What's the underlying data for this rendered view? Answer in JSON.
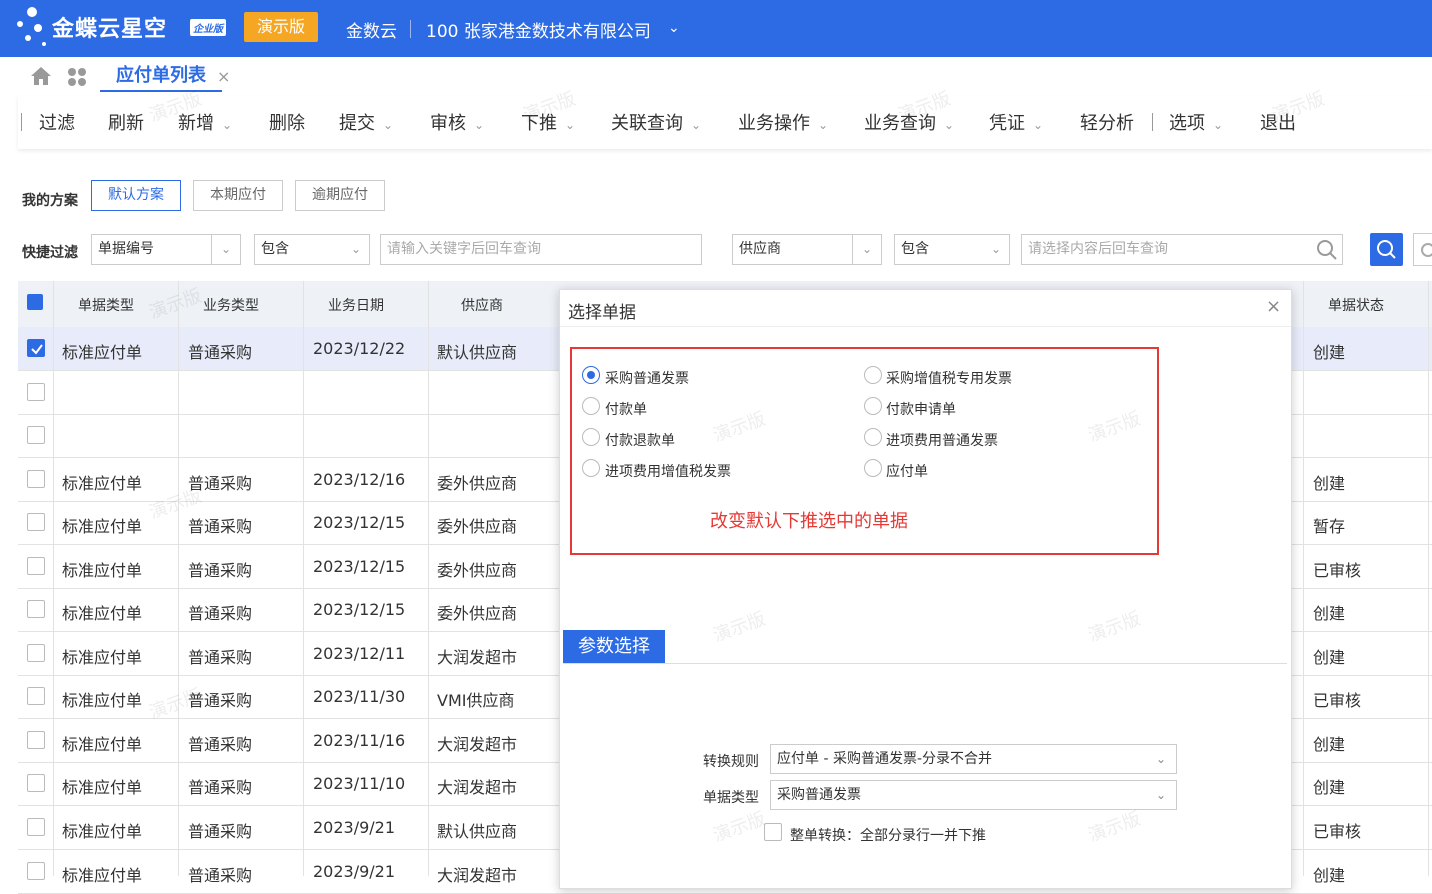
{
  "header": {
    "logo_text": "金蝶云星空",
    "logo_badge": "企业版",
    "demo_label": "演示版",
    "cloud_label": "金数云",
    "company": "100 张家港金数技术有限公司"
  },
  "tabbar": {
    "active_tab": "应付单列表",
    "close": "×"
  },
  "toolbar": {
    "filter": "过滤",
    "refresh": "刷新",
    "new": "新增",
    "delete": "删除",
    "submit": "提交",
    "audit": "审核",
    "push": "下推",
    "related_query": "关联查询",
    "biz_op": "业务操作",
    "biz_query": "业务查询",
    "voucher": "凭证",
    "light_analysis": "轻分析",
    "options": "选项",
    "exit": "退出"
  },
  "scheme": {
    "label": "我的方案",
    "buttons": [
      "默认方案",
      "本期应付",
      "逾期应付"
    ]
  },
  "quick_filter": {
    "label": "快捷过滤",
    "field1": "单据编号",
    "op1": "包含",
    "input1_placeholder": "请输入关键字后回车查询",
    "field2": "供应商",
    "op2": "包含",
    "input2_placeholder": "请选择内容后回车查询"
  },
  "table": {
    "headers": [
      "单据类型",
      "业务类型",
      "业务日期",
      "供应商",
      "单据状态"
    ],
    "rows": [
      {
        "type": "标准应付单",
        "biz": "普通采购",
        "date": "2023/12/22",
        "supplier": "默认供应商",
        "status": "创建",
        "checked": true
      },
      {
        "type": "",
        "biz": "",
        "date": "",
        "supplier": "",
        "status": "",
        "checked": false
      },
      {
        "type": "",
        "biz": "",
        "date": "",
        "supplier": "",
        "status": "",
        "checked": false
      },
      {
        "type": "标准应付单",
        "biz": "普通采购",
        "date": "2023/12/16",
        "supplier": "委外供应商",
        "status": "创建",
        "checked": false
      },
      {
        "type": "标准应付单",
        "biz": "普通采购",
        "date": "2023/12/15",
        "supplier": "委外供应商",
        "status": "暂存",
        "checked": false
      },
      {
        "type": "标准应付单",
        "biz": "普通采购",
        "date": "2023/12/15",
        "supplier": "委外供应商",
        "status": "已审核",
        "checked": false
      },
      {
        "type": "标准应付单",
        "biz": "普通采购",
        "date": "2023/12/15",
        "supplier": "委外供应商",
        "status": "创建",
        "checked": false
      },
      {
        "type": "标准应付单",
        "biz": "普通采购",
        "date": "2023/12/11",
        "supplier": "大润发超市",
        "status": "创建",
        "checked": false
      },
      {
        "type": "标准应付单",
        "biz": "普通采购",
        "date": "2023/11/30",
        "supplier": "VMI供应商",
        "status": "已审核",
        "checked": false
      },
      {
        "type": "标准应付单",
        "biz": "普通采购",
        "date": "2023/11/16",
        "supplier": "大润发超市",
        "status": "创建",
        "checked": false
      },
      {
        "type": "标准应付单",
        "biz": "普通采购",
        "date": "2023/11/10",
        "supplier": "大润发超市",
        "status": "创建",
        "checked": false
      },
      {
        "type": "标准应付单",
        "biz": "普通采购",
        "date": "2023/9/21",
        "supplier": "默认供应商",
        "status": "已审核",
        "checked": false
      },
      {
        "type": "标准应付单",
        "biz": "普通采购",
        "date": "2023/9/21",
        "supplier": "大润发超市",
        "status": "创建",
        "checked": false
      }
    ]
  },
  "watermark": "演示版",
  "dialog": {
    "title": "选择单据",
    "close": "×",
    "options": [
      {
        "label": "采购普通发票",
        "selected": true
      },
      {
        "label": "采购增值税专用发票",
        "selected": false
      },
      {
        "label": "付款单",
        "selected": false
      },
      {
        "label": "付款申请单",
        "selected": false
      },
      {
        "label": "付款退款单",
        "selected": false
      },
      {
        "label": "进项费用普通发票",
        "selected": false
      },
      {
        "label": "进项费用增值税发票",
        "selected": false
      },
      {
        "label": "应付单",
        "selected": false
      }
    ],
    "annotation": "改变默认下推选中的单据",
    "param_tab": "参数选择",
    "rule_label": "转换规则",
    "rule_value": "应付单 - 采购普通发票-分录不合并",
    "type_label": "单据类型",
    "type_value": "采购普通发票",
    "whole_label": "整单转换：全部分录行一并下推"
  },
  "colors": {
    "brand": "#2d6be4",
    "demo_badge": "#f5a623",
    "annotation": "#e53935"
  }
}
